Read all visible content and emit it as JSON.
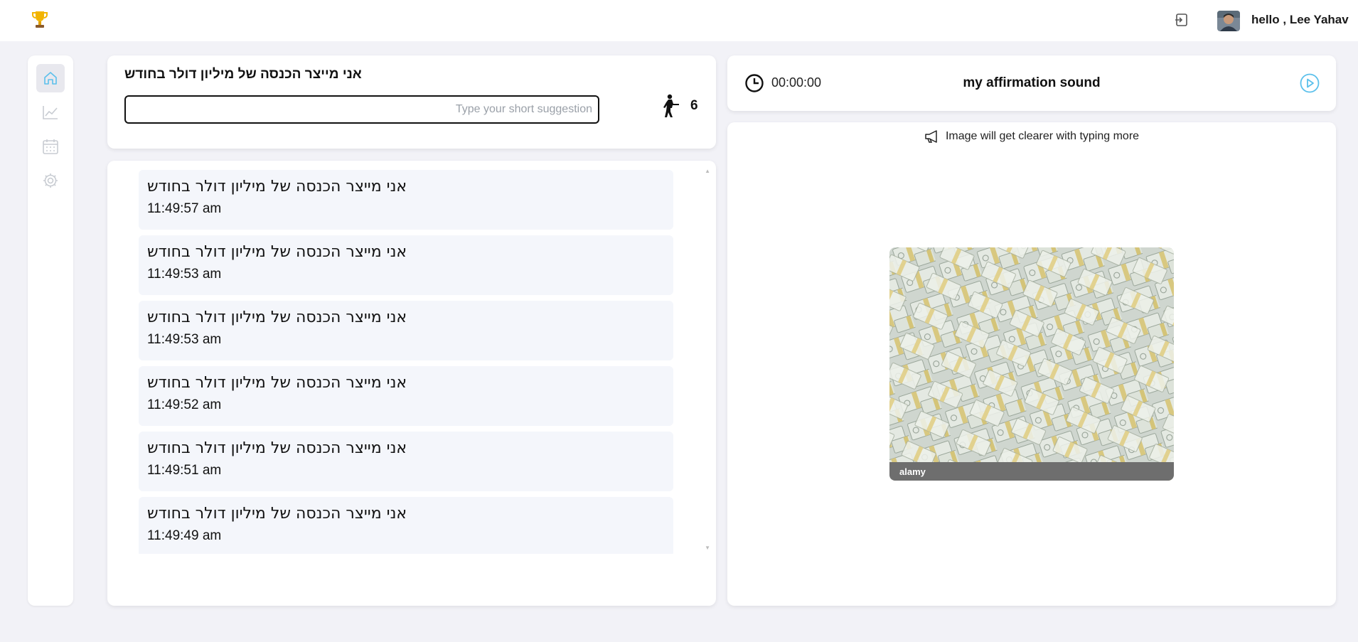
{
  "header": {
    "greeting": "hello , Lee Yahav",
    "logo_icon": "trophy-icon",
    "logout_icon": "logout-icon"
  },
  "sidebar": {
    "items": [
      {
        "name": "home",
        "icon": "home-icon",
        "active": true
      },
      {
        "name": "stats",
        "icon": "chart-line-icon",
        "active": false
      },
      {
        "name": "calendar",
        "icon": "calendar-icon",
        "active": false
      },
      {
        "name": "settings",
        "icon": "gear-icon",
        "active": false
      }
    ]
  },
  "affirmation": {
    "title": "אני מייצר הכנסה של מיליון דולר בחודש",
    "input_value": "",
    "input_placeholder": "Type your short suggestion",
    "count": "6"
  },
  "entries": [
    {
      "text": "אני מייצר הכנסה של מיליון דולר בחודש",
      "time": "11:49:57 am"
    },
    {
      "text": "אני מייצר הכנסה של מיליון דולר בחודש",
      "time": "11:49:53 am"
    },
    {
      "text": "אני מייצר הכנסה של מיליון דולר בחודש",
      "time": "11:49:53 am"
    },
    {
      "text": "אני מייצר הכנסה של מיליון דולר בחודש",
      "time": "11:49:52 am"
    },
    {
      "text": "אני מייצר הכנסה של מיליון דולר בחודש",
      "time": "11:49:51 am"
    },
    {
      "text": "אני מייצר הכנסה של מיליון דולר בחודש",
      "time": "11:49:49 am"
    }
  ],
  "sound": {
    "timer": "00:00:00",
    "title": "my affirmation sound"
  },
  "image_panel": {
    "hint": "Image will get clearer with typing more",
    "watermark": "alamy"
  },
  "colors": {
    "accent": "#5bc0eb",
    "background": "#f2f2f7",
    "entry_bg": "#f4f6fb"
  }
}
